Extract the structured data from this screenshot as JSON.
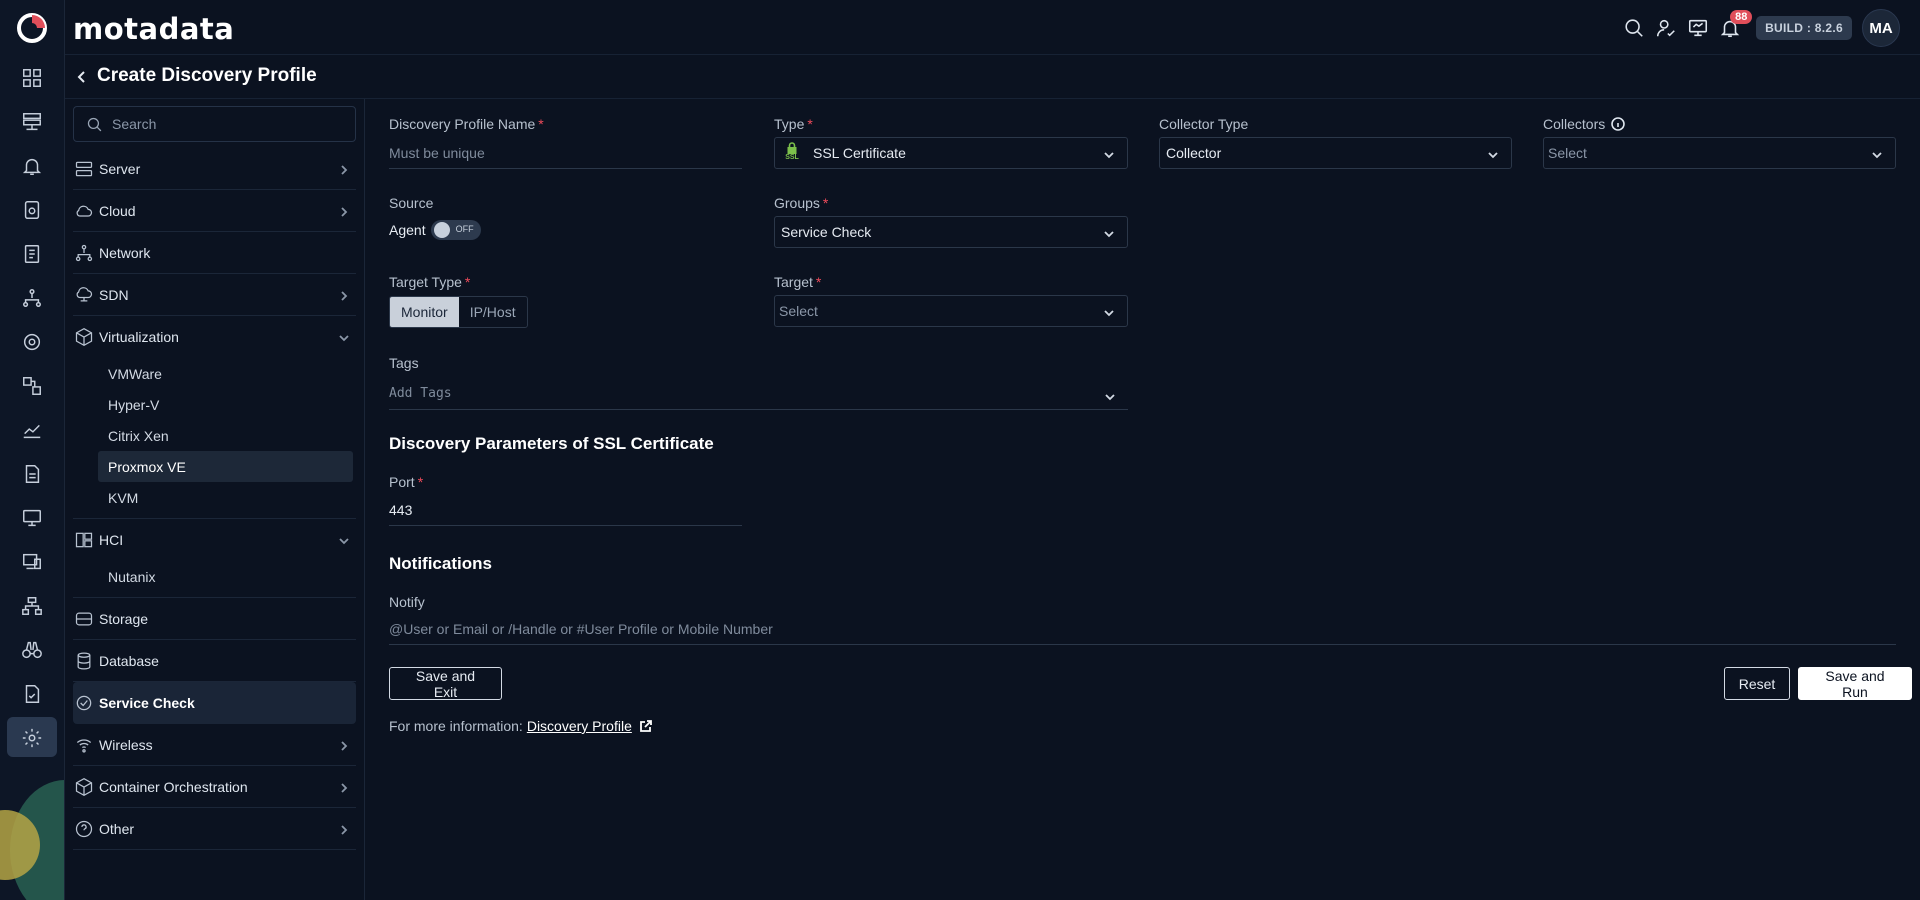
{
  "app": {
    "brand": "motadata"
  },
  "header": {
    "notification_count": "88",
    "build": "BUILD : 8.2.6",
    "avatar_initials": "MA",
    "icons": [
      "search-icon",
      "user-check-icon",
      "monitor-icon",
      "bell-icon"
    ]
  },
  "rail": {
    "icons": [
      "dashboard-icon",
      "server-rack-icon",
      "alert-bell-icon",
      "metric-icon",
      "report-icon",
      "topology-icon",
      "discovery-icon",
      "integration-icon",
      "chart-icon",
      "document-icon",
      "monitor-icon",
      "desktop-icon",
      "network-icon",
      "binoculars-icon",
      "audit-icon",
      "settings-icon"
    ],
    "active": "settings-icon"
  },
  "page": {
    "title": "Create Discovery Profile"
  },
  "sidebar": {
    "search_placeholder": "Search",
    "items": [
      {
        "label": "Server",
        "icon": "server-icon",
        "expandable": true
      },
      {
        "label": "Cloud",
        "icon": "cloud-icon",
        "expandable": true
      },
      {
        "label": "Network",
        "icon": "network-icon",
        "expandable": false
      },
      {
        "label": "SDN",
        "icon": "sdn-cloud-icon",
        "expandable": true
      },
      {
        "label": "Virtualization",
        "icon": "cube-icon",
        "expanded": true,
        "children": [
          "VMWare",
          "Hyper-V",
          "Citrix Xen",
          "Proxmox VE",
          "KVM"
        ],
        "active_child": "Proxmox VE"
      },
      {
        "label": "HCI",
        "icon": "hci-icon",
        "expanded": true,
        "children": [
          "Nutanix"
        ]
      },
      {
        "label": "Storage",
        "icon": "storage-icon",
        "expandable": false
      },
      {
        "label": "Database",
        "icon": "database-icon",
        "expandable": false
      },
      {
        "label": "Service Check",
        "icon": "service-check-icon",
        "active": true
      },
      {
        "label": "Wireless",
        "icon": "wireless-icon",
        "expandable": true
      },
      {
        "label": "Container Orchestration",
        "icon": "container-icon",
        "expandable": true
      },
      {
        "label": "Other",
        "icon": "question-icon",
        "expandable": true
      }
    ]
  },
  "form": {
    "profile_name": {
      "label": "Discovery Profile Name",
      "placeholder": "Must be unique"
    },
    "type": {
      "label": "Type",
      "value": "SSL Certificate",
      "icon_text": "SSL"
    },
    "collector_type": {
      "label": "Collector Type",
      "value": "Collector"
    },
    "collectors": {
      "label": "Collectors",
      "placeholder": "Select"
    },
    "source": {
      "label": "Source",
      "agent_label": "Agent",
      "toggle_state": "OFF"
    },
    "groups": {
      "label": "Groups",
      "value": "Service Check"
    },
    "target_type": {
      "label": "Target Type",
      "options": [
        "Monitor",
        "IP/Host"
      ],
      "selected": "Monitor"
    },
    "target": {
      "label": "Target",
      "placeholder": "Select"
    },
    "tags": {
      "label": "Tags",
      "placeholder": "Add Tags"
    },
    "params_title": "Discovery Parameters of SSL Certificate",
    "port": {
      "label": "Port",
      "value": "443"
    },
    "notifications_title": "Notifications",
    "notify": {
      "label": "Notify",
      "placeholder": "@User or Email or /Handle or #User Profile or Mobile Number"
    }
  },
  "actions": {
    "save_exit": "Save and Exit",
    "reset": "Reset",
    "save_run": "Save and Run"
  },
  "more_info": {
    "prefix": "For more information:",
    "link": "Discovery Profile"
  },
  "colors": {
    "background": "#0b1220",
    "required": "#ef4b5b",
    "badge": "#e04e5a",
    "ssl_green": "#7cc04b"
  }
}
